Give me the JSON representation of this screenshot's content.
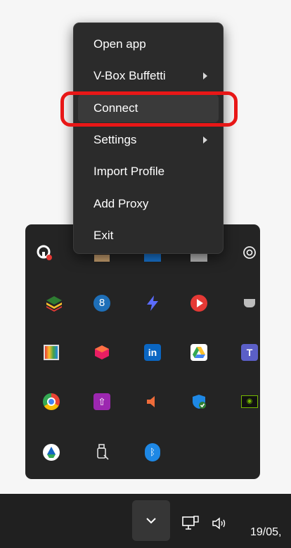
{
  "menu": {
    "items": [
      {
        "label": "Open app",
        "submenu": false
      },
      {
        "label": "V-Box Buffetti",
        "submenu": true
      },
      {
        "label": "Connect",
        "submenu": false
      },
      {
        "label": "Settings",
        "submenu": true
      },
      {
        "label": "Import Profile",
        "submenu": false
      },
      {
        "label": "Add Proxy",
        "submenu": false
      },
      {
        "label": "Exit",
        "submenu": false
      }
    ],
    "highlighted": "Connect"
  },
  "tray": {
    "icons": [
      "vpn-app-icon",
      "mail-icon",
      "outlook-icon",
      "snipping-tool-icon",
      "chatgpt-icon",
      "bluestacks-icon",
      "eight-icon",
      "bolt-icon",
      "youtube-icon",
      "cup-icon",
      "color-picker-icon",
      "cube-icon",
      "linkedin-icon",
      "google-drive-icon",
      "teams-icon",
      "chrome-icon",
      "upload-icon",
      "speaker-app-icon",
      "defender-icon",
      "nvidia-icon",
      "drive-sync-icon",
      "usb-icon",
      "bluetooth-icon"
    ]
  },
  "taskbar": {
    "clock_text": "19/05,"
  },
  "colors": {
    "menu_bg": "#2b2b2b",
    "highlight_ring": "#e81717",
    "tray_bg": "#242424",
    "taskbar_bg": "#202020"
  }
}
